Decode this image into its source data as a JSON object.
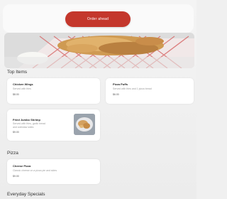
{
  "header": {
    "order_button_label": "Order ahead"
  },
  "sections": {
    "top_items": {
      "title": "Top Items",
      "items": [
        {
          "name": "Chicken Wings",
          "desc": "Served with fries",
          "price": "$8.00"
        },
        {
          "name": "Pizza Puffs",
          "desc": "Served with fries and 1 pizza bread",
          "price": "$6.00"
        },
        {
          "name": "Fried Jumbo Shrimp",
          "desc": "Served with fries, garlic bread",
          "desc2": "and coleslaw sides",
          "price": "$9.00"
        }
      ]
    },
    "pizza": {
      "title": "Pizza",
      "items": [
        {
          "name": "Cheese Pizza",
          "desc": "Classic cheese on a pizza pie and sides",
          "price": "$9.00"
        }
      ]
    },
    "everyday_specials": {
      "title": "Everyday Specials"
    }
  },
  "colors": {
    "accent": "#c4372c",
    "background": "#efefef",
    "card": "#ffffff"
  }
}
